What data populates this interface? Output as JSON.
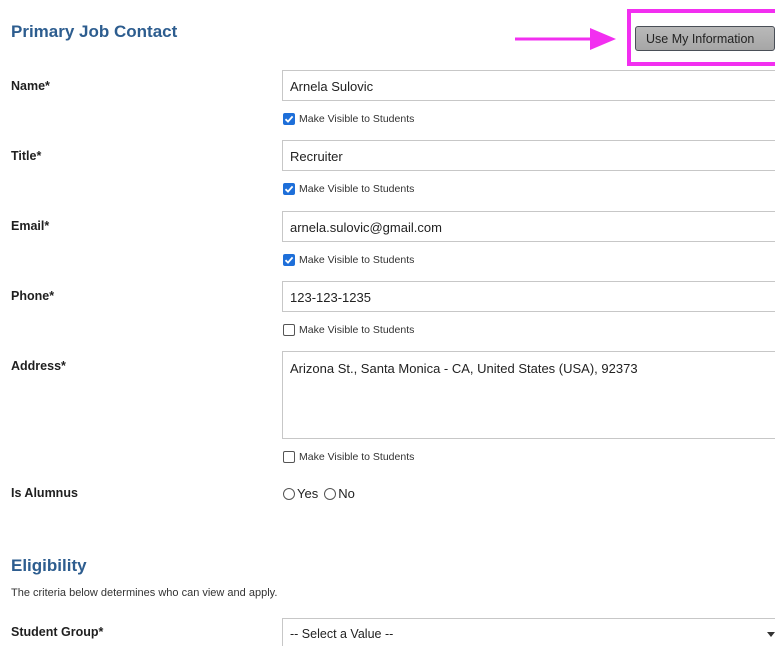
{
  "primary_contact": {
    "heading": "Primary Job Contact",
    "use_my_info_label": "Use My Information",
    "visible_label": "Make Visible to Students",
    "fields": {
      "name": {
        "label": "Name*",
        "value": "Arnela Sulovic",
        "visible": true
      },
      "title": {
        "label": "Title*",
        "value": "Recruiter",
        "visible": true
      },
      "email": {
        "label": "Email*",
        "value": "arnela.sulovic@gmail.com",
        "visible": true
      },
      "phone": {
        "label": "Phone*",
        "value": "123-123-1235",
        "visible": false
      },
      "address": {
        "label": "Address*",
        "value": "Arizona St., Santa Monica - CA, United States (USA), 92373",
        "visible": false
      }
    },
    "alumnus": {
      "label": "Is Alumnus",
      "options": [
        "Yes",
        "No"
      ],
      "selected": null
    }
  },
  "eligibility": {
    "heading": "Eligibility",
    "description": "The criteria below determines who can view and apply.",
    "student_group": {
      "label": "Student Group*",
      "selected": "-- Select a Value --"
    }
  },
  "annotation": {
    "arrow_color": "#f22ff0",
    "highlight_color": "#f22ff0"
  },
  "colors": {
    "heading": "#2d5d8f",
    "checkbox": "#1e6fd9"
  }
}
